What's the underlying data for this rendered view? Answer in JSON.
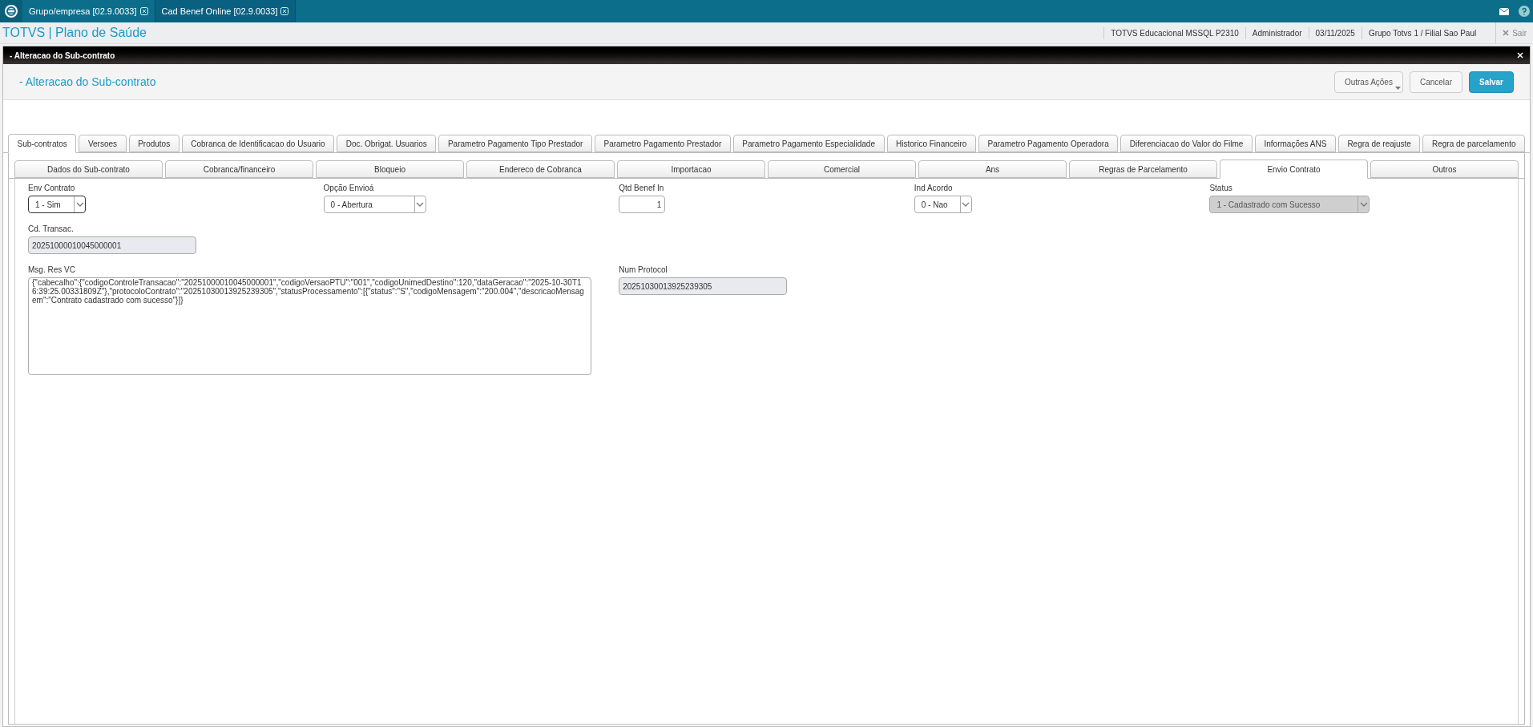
{
  "app_tabs": [
    {
      "label": "Grupo/empresa [02.9.0033]",
      "selected": false
    },
    {
      "label": "Cad Benef Online [02.9.0033]",
      "selected": true
    }
  ],
  "header": {
    "title": "TOTVS | Plano de Saúde",
    "info": [
      "TOTVS Educacional MSSQL P2310",
      "Administrador",
      "03/11/2025",
      "Grupo Totvs 1 / Filial Sao Paul"
    ],
    "exit": "Sair"
  },
  "window": {
    "title": "- Alteracao do Sub-contrato",
    "heading": "- Alteracao do Sub-contrato",
    "buttons": [
      {
        "label": "Outras Ações",
        "kind": "menu"
      },
      {
        "label": "Cancelar",
        "kind": "plain"
      },
      {
        "label": "Salvar",
        "kind": "primary"
      }
    ]
  },
  "tabs": [
    {
      "label": "Sub-contratos",
      "selected": true
    },
    {
      "label": "Versoes",
      "selected": false
    },
    {
      "label": "Produtos",
      "selected": false
    },
    {
      "label": "Cobranca de Identificacao do Usuario",
      "selected": false
    },
    {
      "label": "Doc. Obrigat. Usuarios",
      "selected": false
    },
    {
      "label": "Parametro Pagamento Tipo Prestador",
      "selected": false
    },
    {
      "label": "Parametro Pagamento Prestador",
      "selected": false
    },
    {
      "label": "Parametro Pagamento Especialidade",
      "selected": false
    },
    {
      "label": "Historico Financeiro",
      "selected": false
    },
    {
      "label": "Parametro Pagamento Operadora",
      "selected": false
    },
    {
      "label": "Diferenciacao do Valor do Filme",
      "selected": false
    },
    {
      "label": "Informações ANS",
      "selected": false
    },
    {
      "label": "Regra de reajuste",
      "selected": false
    },
    {
      "label": "Regra de parcelamento",
      "selected": false
    }
  ],
  "subtabs": [
    {
      "label": "Dados do Sub-contrato",
      "selected": false
    },
    {
      "label": "Cobranca/financeiro",
      "selected": false
    },
    {
      "label": "Bloqueio",
      "selected": false
    },
    {
      "label": "Endereco de Cobranca",
      "selected": false
    },
    {
      "label": "Importacao",
      "selected": false
    },
    {
      "label": "Comercial",
      "selected": false
    },
    {
      "label": "Ans",
      "selected": false
    },
    {
      "label": "Regras de Parcelamento",
      "selected": false
    },
    {
      "label": "Envio Contrato",
      "selected": true
    },
    {
      "label": "Outros",
      "selected": false
    }
  ],
  "form_rows": [
    [
      {
        "kind": "select",
        "label": "Env Contrato",
        "value": "1 - Sim",
        "focused": true,
        "readonly": false
      },
      {
        "kind": "select",
        "label": "Opção Envioá",
        "value": "0 - Abertura",
        "focused": false,
        "readonly": false
      },
      {
        "kind": "input",
        "label": "Qtd Benef In",
        "value": "1",
        "focused": false,
        "readonly": false
      },
      {
        "kind": "select",
        "label": "Ind Acordo",
        "value": "0 - Nao",
        "focused": false,
        "readonly": false
      },
      {
        "kind": "select",
        "label": "Status",
        "value": "1 - Cadastrado com Sucesso",
        "focused": false,
        "readonly": true
      }
    ],
    [
      {
        "kind": "input",
        "label": "Cd. Transac.",
        "value": "20251000010045000001",
        "focused": false,
        "readonly": true
      }
    ],
    [
      {
        "kind": "textarea",
        "label": "Msg. Res VC",
        "value": "{\"cabecalho\":{\"codigoControleTransacao\":\"20251000010045000001\",\"codigoVersaoPTU\":\"001\",\"codigoUnimedDestino\":120,\"dataGeracao\":\"2025-10-30T16:39:25.00331809Z\"},\"protocoloContrato\":\"20251030013925239305\",\"statusProcessamento\":[{\"status\":\"S\",\"codigoMensagem\":\"200.004\",\"descricaoMensagem\":\"Contrato cadastrado com sucesso\"}]}",
        "focused": false,
        "readonly": false
      },
      {
        "kind": "input",
        "label": "Num Protocol",
        "value": "20251030013925239305",
        "focused": false,
        "readonly": true
      }
    ]
  ]
}
